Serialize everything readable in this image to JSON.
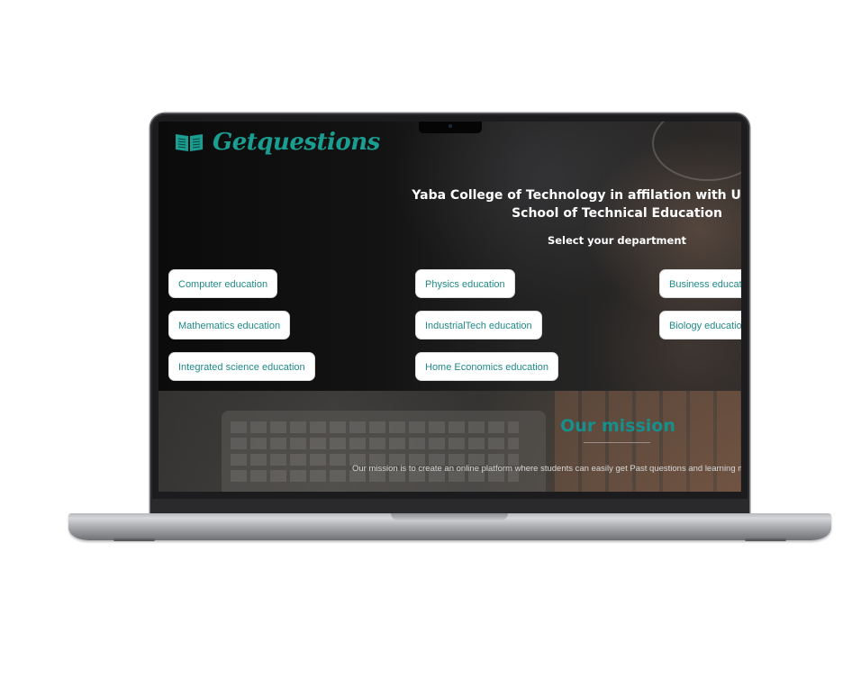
{
  "brand": {
    "name": "Getquestions",
    "color": "#1a9e91"
  },
  "hero": {
    "title_line1": "Yaba College of Technology in affilation with University of",
    "title_line2": "School of Technical Education",
    "select_label": "Select your department"
  },
  "departments": [
    "Computer education",
    "Physics education",
    "Business education",
    "Mathematics education",
    "IndustrialTech education",
    "Biology education",
    "Integrated science education",
    "Home Economics education"
  ],
  "mission": {
    "title": "Our mission",
    "text": "Our mission is to create an online platform where students can easily get Past questions and learning materials"
  },
  "colors": {
    "accent": "#1f8a88",
    "button_bg": "#ffffff"
  }
}
